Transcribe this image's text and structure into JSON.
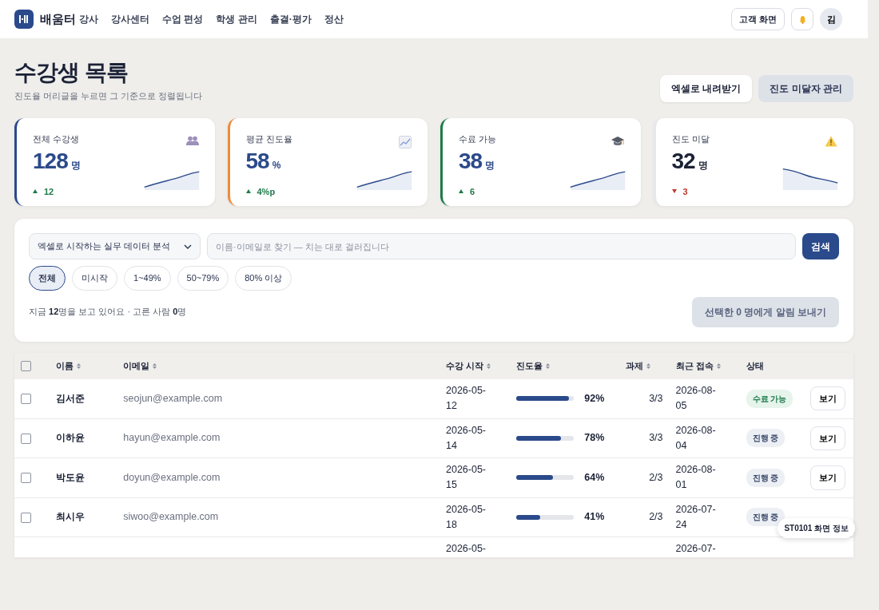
{
  "navbar": {
    "brand": "배움터",
    "role": "강사",
    "items": [
      "강사센터",
      "수업 편성",
      "학생 관리",
      "출결·평가",
      "정산"
    ],
    "customer_button": "고객 화면",
    "avatar": "김"
  },
  "header": {
    "title": "수강생 목록",
    "subtitle": "진도율 머리글을 누르면 그 기준으로 정렬됩니다",
    "buttons": [
      {
        "label": "엑셀로 내려받기",
        "kind": "light"
      },
      {
        "label": "진도 미달자 관리",
        "kind": "muted"
      }
    ]
  },
  "stats": [
    {
      "label": "전체 수강생",
      "value": "128",
      "unit": "명",
      "delta": "12",
      "rising": true,
      "color": "#2b4a8b"
    },
    {
      "label": "평균 진도율",
      "value": "58",
      "unit": "%",
      "delta": "4%p",
      "rising": true,
      "color": "#f08a3c"
    },
    {
      "label": "수료 가능",
      "value": "38",
      "unit": "명",
      "delta": "6",
      "rising": true,
      "color": "#1e7a4a"
    },
    {
      "label": "진도 미달",
      "value": "32",
      "unit": "명",
      "delta": "3",
      "rising": false,
      "color": "#e6e8ee"
    }
  ],
  "filters": {
    "course": "엑셀로 시작하는 실무 데이터 분석",
    "search": {
      "placeholder": "이름·이메일로 찾기 — 치는 대로 걸러집니다"
    },
    "search_button": "검색",
    "chips": [
      {
        "label": "전체",
        "selected": true
      },
      {
        "label": "미시작",
        "selected": false
      },
      {
        "label": "1~49%",
        "selected": false
      },
      {
        "label": "50~79%",
        "selected": false
      },
      {
        "label": "80% 이상",
        "selected": false
      }
    ],
    "summary": "지금 **12**명을 보고 있어요 · 고른 사람 **0**명",
    "notify_button": {
      "label": "선택한 **0** 명에게 알림 보내기",
      "disabled": true
    }
  },
  "table": {
    "all_selected": false,
    "columns": [
      {
        "label": "이름",
        "sortable": true
      },
      {
        "label": "이메일",
        "sortable": true
      },
      {
        "label": "수강 시작",
        "sortable": true
      },
      {
        "label": "진도율",
        "sortable": true
      },
      {
        "label": "과제",
        "sortable": true
      },
      {
        "label": "최근 접속",
        "sortable": true
      },
      {
        "label": "상태",
        "sortable": false
      }
    ],
    "rows": [
      {
        "checked": false,
        "name": "김서준",
        "email": "seojun@example.com",
        "start": "2026-05-12",
        "level": 0.92,
        "progress": "92%",
        "tasks": "3/3",
        "last_access": "2026-08-05",
        "status": {
          "label": "수료 가능",
          "kind": "done"
        },
        "action": "보기"
      },
      {
        "checked": false,
        "name": "이하윤",
        "email": "hayun@example.com",
        "start": "2026-05-14",
        "level": 0.78,
        "progress": "78%",
        "tasks": "3/3",
        "last_access": "2026-08-04",
        "status": {
          "label": "진행 중",
          "kind": "progress"
        },
        "action": "보기"
      },
      {
        "checked": false,
        "name": "박도윤",
        "email": "doyun@example.com",
        "start": "2026-05-15",
        "level": 0.64,
        "progress": "64%",
        "tasks": "2/3",
        "last_access": "2026-08-01",
        "status": {
          "label": "진행 중",
          "kind": "progress"
        },
        "action": "보기"
      },
      {
        "checked": false,
        "name": "최시우",
        "email": "siwoo@example.com",
        "start": "2026-05-18",
        "level": 0.41,
        "progress": "41%",
        "tasks": "2/3",
        "last_access": "2026-07-24",
        "status": {
          "label": "진행 중",
          "kind": "progress"
        }
      },
      {
        "start": "2026-05-",
        "last_access": "2026-07-"
      }
    ]
  },
  "screen_info": "ST0101 화면 정보"
}
